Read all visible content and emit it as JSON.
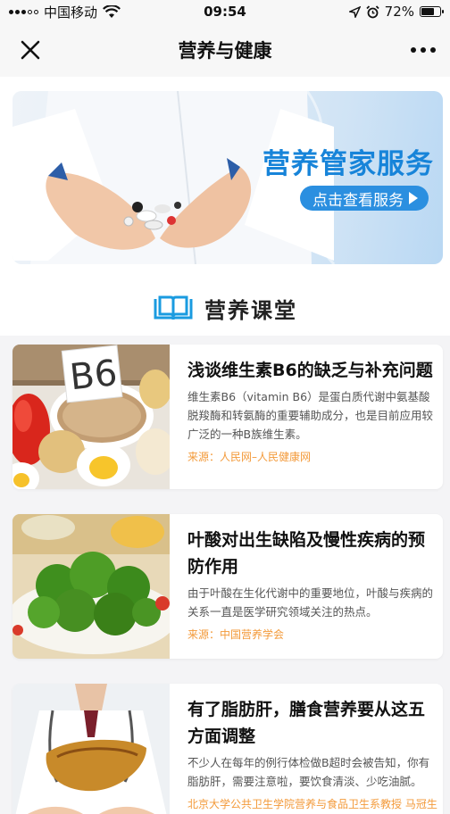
{
  "status_bar": {
    "carrier": "中国移动",
    "time": "09:54",
    "battery": "72%",
    "battery_level": 0.72
  },
  "nav": {
    "title": "营养与健康"
  },
  "banner": {
    "title": "营养管家服务",
    "button_label": "点击查看服务"
  },
  "section": {
    "title": "营养课堂"
  },
  "articles": [
    {
      "title": "浅谈维生素B6的缺乏与补充问题",
      "description": "维生素B6（vitamin B6）是蛋白质代谢中氨基酸脱羧酶和转氨酶的重要辅助成分，也是目前应用较广泛的一种B族维生素。",
      "source": "来源：人民网–人民健康网",
      "thumb_label": "B6"
    },
    {
      "title": "叶酸对出生缺陷及慢性疾病的预防作用",
      "description": "由于叶酸在生化代谢中的重要地位，叶酸与疾病的关系一直是医学研究领域关注的热点。",
      "source": "来源：中国营养学会"
    },
    {
      "title": "有了脂肪肝，膳食营养要从这五方面调整",
      "description": "不少人在每年的例行体检做B超时会被告知，你有脂肪肝，需要注意啦，要饮食清淡、少吃油腻。",
      "source": "北京大学公共卫生学院营养与食品卫生系教授 马冠生"
    }
  ],
  "colors": {
    "accent_blue": "#1784d9",
    "source_orange": "#f39a3a"
  }
}
